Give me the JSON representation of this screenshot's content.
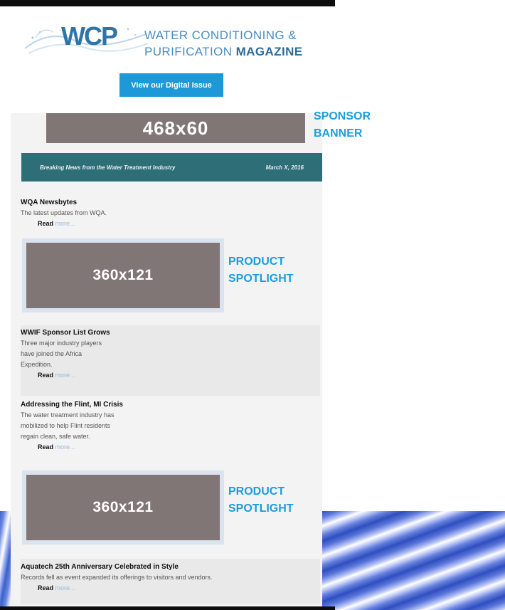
{
  "header": {
    "logo_title_line1": "WATER CONDITIONING &",
    "logo_title_line2_prefix": "PURIFICATION",
    "logo_title_line2_bold": "MAGAZINE",
    "digital_button": "View our Digital Issue"
  },
  "sponsor_banner": {
    "size": "468x60",
    "label_line1": "SPONSOR",
    "label_line2": "BANNER"
  },
  "strip": {
    "title": "Breaking News from the Water Treatment Industry",
    "date": "March X, 2016"
  },
  "items": [
    {
      "title": "WQA Newsbytes",
      "lines": [
        "The latest updates from WQA."
      ],
      "read": "Read",
      "more": "more..."
    },
    {
      "title": "WWIF Sponsor List Grows",
      "lines": [
        "Three major industry players",
        "have joined the Africa",
        "Expedition."
      ],
      "read": "Read",
      "more": "more..."
    },
    {
      "title": "Addressing the Flint, MI Crisis",
      "lines": [
        "The water treatment industry has",
        "mobilized to help Flint residents",
        "regain clean, safe water."
      ],
      "read": "Read",
      "more": "more..."
    },
    {
      "title": "Aquatech 25th Anniversary Celebrated in Style",
      "lines": [
        "Records fell as event expanded its offerings to visitors and vendors."
      ],
      "read": "Read",
      "more": "more..."
    }
  ],
  "product_spotlights": [
    {
      "size": "360x121",
      "label_line1": "PRODUCT",
      "label_line2": "SPOTLIGHT"
    },
    {
      "size": "360x121",
      "label_line1": "PRODUCT",
      "label_line2": "SPOTLIGHT"
    }
  ],
  "colors": {
    "accent": "#1a9ddd",
    "ad_gray": "#807675",
    "strip_teal": "#2e6e76"
  }
}
